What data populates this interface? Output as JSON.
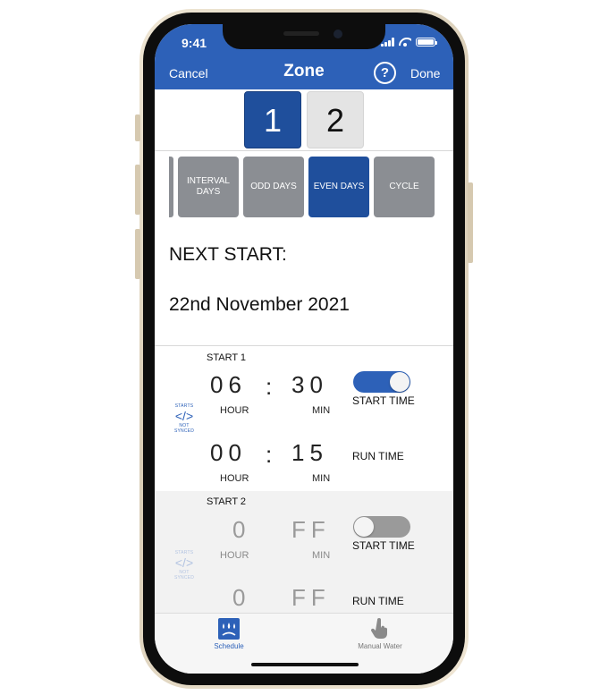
{
  "status_bar": {
    "time": "9:41"
  },
  "nav": {
    "cancel": "Cancel",
    "title": "Zone",
    "help": "?",
    "done": "Done"
  },
  "programs": [
    "1",
    "2"
  ],
  "day_modes": [
    "INTERVAL DAYS",
    "ODD DAYS",
    "EVEN DAYS",
    "CYCLE"
  ],
  "selected_day_mode": "EVEN DAYS",
  "next_start": {
    "label": "NEXT START:",
    "date": "22nd November 2021"
  },
  "starts": [
    {
      "label": "START 1",
      "start_hour": "06",
      "start_min": "30",
      "run_hour": "00",
      "run_min": "15",
      "start_time_enabled": true
    },
    {
      "label": "START 2",
      "start_hour": "0",
      "start_min": "FF",
      "run_hour": "0",
      "run_min": "FF",
      "start_time_enabled": false
    }
  ],
  "labels": {
    "hour": "HOUR",
    "min": "MIN",
    "colon": ":",
    "start_time": "START TIME",
    "run_time": "RUN TIME",
    "sync_top": "STARTS",
    "sync_bottom": "NOT SYNCED"
  },
  "tabs": {
    "schedule": "Schedule",
    "manual_water": "Manual Water"
  },
  "colors": {
    "header_blue": "#2d61b8",
    "selected_blue": "#1f4f9c",
    "tile_gray": "#8b8e93"
  }
}
